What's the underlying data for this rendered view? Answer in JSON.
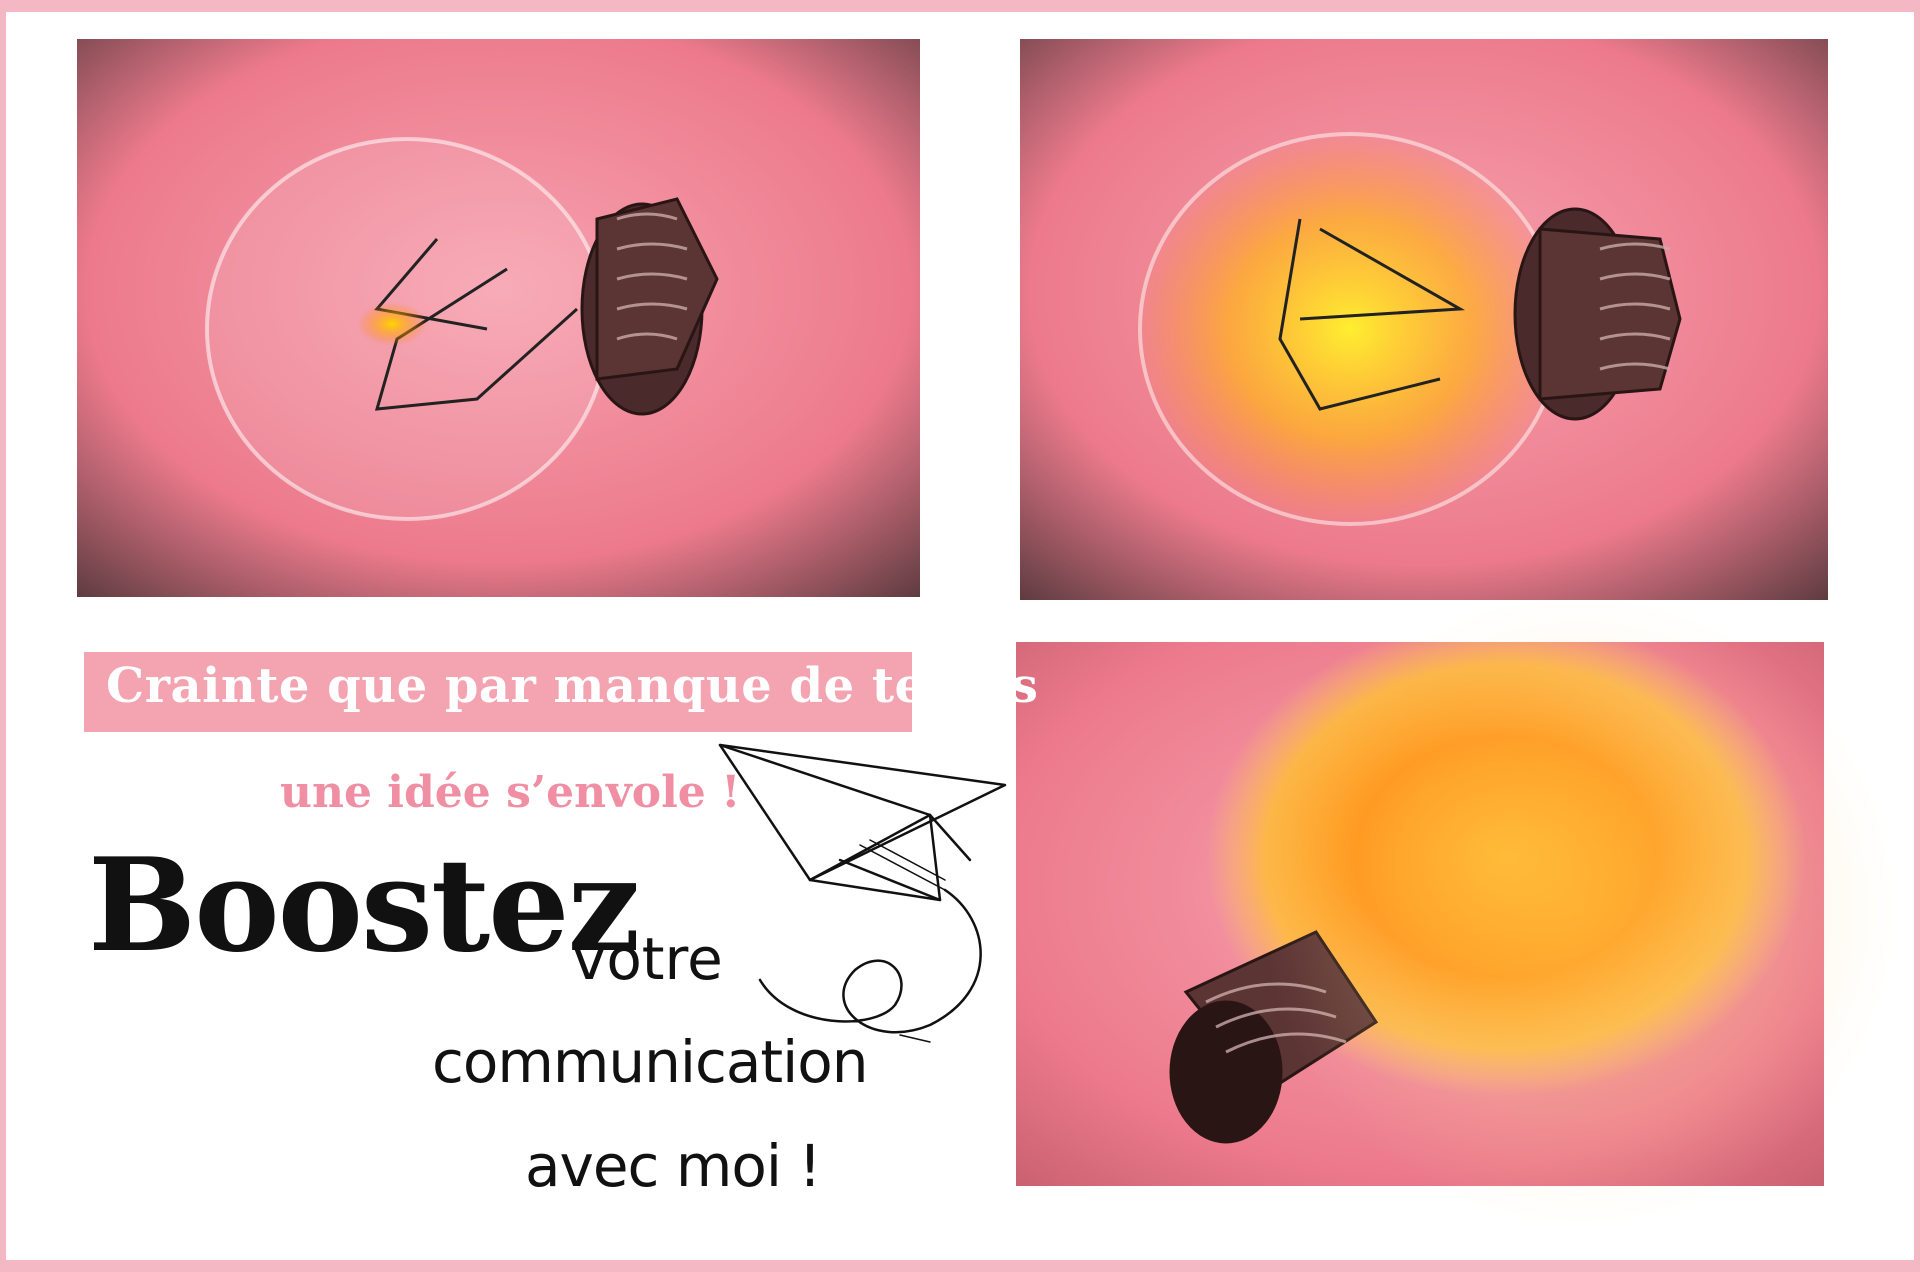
{
  "texts": {
    "banner": "Crainte que par manque de temps",
    "subline": "une idée s’envole !",
    "headline": "Boostez",
    "line1": "votre",
    "line2": "communication",
    "line3": "avec moi !"
  },
  "colors": {
    "frame": "#f4b8c4",
    "banner_bg": "#f4a3b1",
    "subline": "#f08ea3",
    "text_dark": "#111111",
    "photo_bg": "#ee7f90"
  },
  "icons": [
    "light-bulb-icon",
    "paper-plane-icon"
  ]
}
